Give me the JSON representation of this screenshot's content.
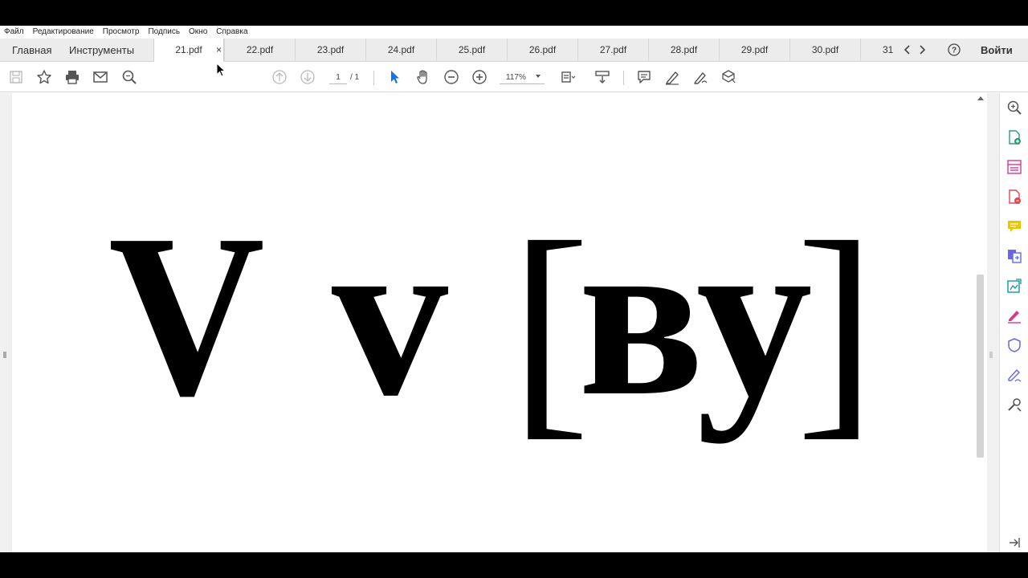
{
  "menu": [
    "Файл",
    "Редактирование",
    "Просмотр",
    "Подпись",
    "Окно",
    "Справка"
  ],
  "tabbar": {
    "home": "Главная",
    "tools": "Инструменты",
    "documents": [
      "21.pdf",
      "22.pdf",
      "23.pdf",
      "24.pdf",
      "25.pdf",
      "26.pdf",
      "27.pdf",
      "28.pdf",
      "29.pdf",
      "30.pdf",
      "31"
    ],
    "active_index": 0,
    "close_symbol": "×",
    "signin": "Войти"
  },
  "toolbar": {
    "page_current": "1",
    "page_total": "/ 1",
    "zoom": "117%"
  },
  "document": {
    "letter_upper": "V",
    "letter_lower": "v",
    "bracket_open": "[",
    "transcription": "ву",
    "bracket_close": "]"
  },
  "colors": {
    "accent_blue": "#1473e6",
    "tool_green": "#2d9d78",
    "tool_pink": "#d83790",
    "tool_red": "#e34850",
    "tool_yellow": "#e8c600",
    "tool_purple": "#6767ec",
    "tool_teal": "#0d98a8"
  },
  "icons": {
    "right_panel": [
      "search-pages-icon",
      "create-pdf-icon",
      "organize-pages-icon",
      "export-pdf-icon",
      "comment-icon",
      "combine-files-icon",
      "edit-pdf-icon",
      "fill-sign-icon",
      "protect-icon",
      "request-signatures-icon",
      "more-tools-icon"
    ]
  }
}
